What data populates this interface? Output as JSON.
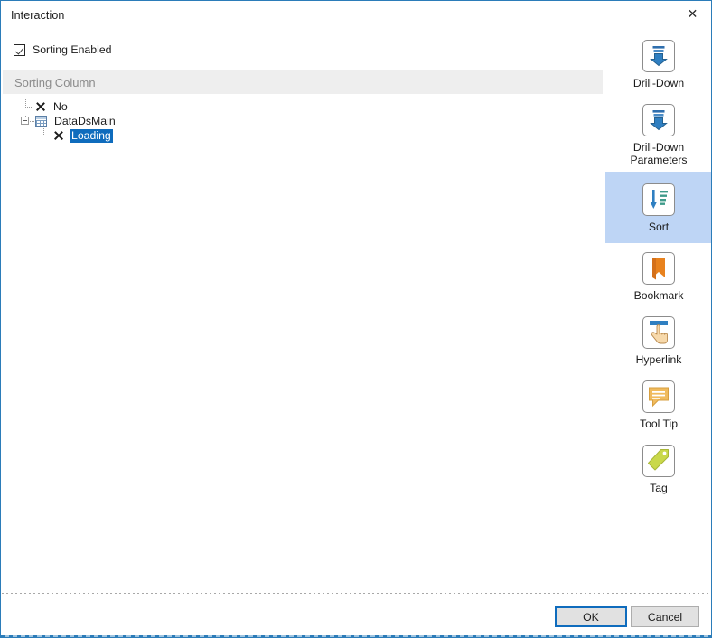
{
  "window": {
    "title": "Interaction",
    "close_icon": "close-icon",
    "border_color": "#2b7cb9"
  },
  "options": {
    "sorting_enabled": {
      "label": "Sorting Enabled",
      "checked": true
    },
    "group_header": "Sorting Column"
  },
  "tree": {
    "nodes": [
      {
        "label": "No",
        "icon": "x-icon",
        "level": 0,
        "selected": false,
        "expandable": false
      },
      {
        "label": "DataDsMain",
        "icon": "table-icon",
        "level": 0,
        "selected": false,
        "expandable": true,
        "expanded": true
      },
      {
        "label": "Loading",
        "icon": "x-icon",
        "level": 1,
        "selected": true,
        "expandable": false
      }
    ],
    "selection_color": "#0f6cbd"
  },
  "sidebar": {
    "selected_index": 2,
    "highlight_color": "#bed5f5",
    "items": [
      {
        "label": "Drill-Down",
        "icon": "drill-down-icon"
      },
      {
        "label": "Drill-Down\nParameters",
        "icon": "drill-down-parameters-icon"
      },
      {
        "label": "Sort",
        "icon": "sort-icon"
      },
      {
        "label": "Bookmark",
        "icon": "bookmark-icon"
      },
      {
        "label": "Hyperlink",
        "icon": "hyperlink-icon"
      },
      {
        "label": "Tool Tip",
        "icon": "tool-tip-icon"
      },
      {
        "label": "Tag",
        "icon": "tag-icon"
      }
    ]
  },
  "footer": {
    "ok_label": "OK",
    "cancel_label": "Cancel",
    "default_button_color": "#0f6cbd"
  }
}
